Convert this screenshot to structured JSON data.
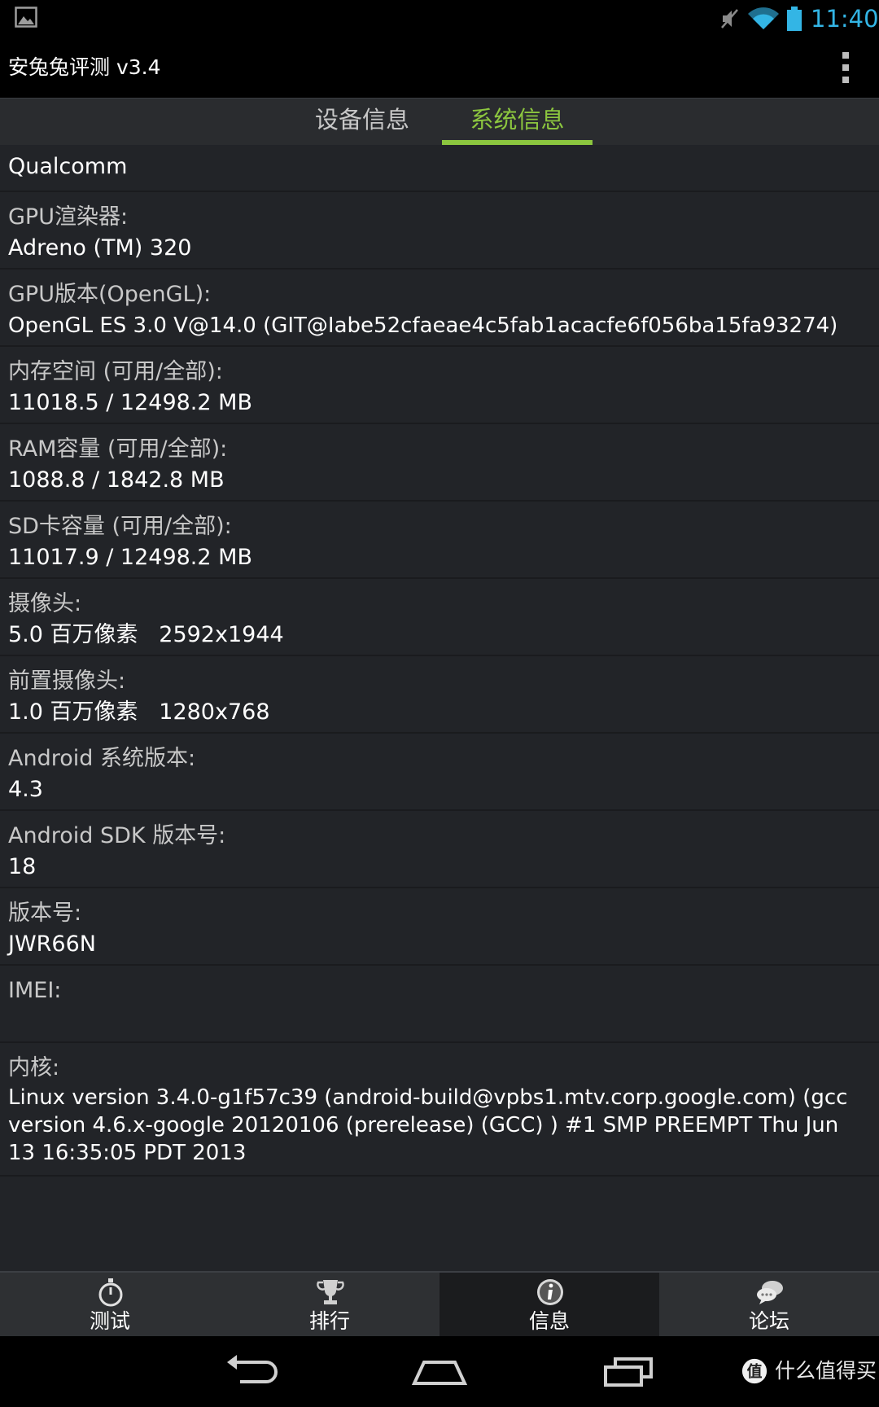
{
  "status_bar": {
    "time": "11:40",
    "icons": [
      "gallery-icon",
      "mute-icon",
      "wifi-icon",
      "battery-icon"
    ],
    "accent_color": "#33b5e5"
  },
  "app": {
    "title": "安兔兔评测 v3.4"
  },
  "tabs": [
    {
      "label": "设备信息",
      "active": false
    },
    {
      "label": "系统信息",
      "active": true
    }
  ],
  "accent_color": "#8cc63f",
  "info": {
    "cpu_vendor": "Qualcomm",
    "gpu_renderer": {
      "label": "GPU渲染器:",
      "value": "Adreno (TM) 320"
    },
    "gpu_version": {
      "label": "GPU版本(OpenGL):",
      "value": "OpenGL ES 3.0 V@14.0 (GIT@Iabe52cfaeae4c5fab1acacfe6f056ba15fa93274)"
    },
    "storage": {
      "label": "内存空间 (可用/全部):",
      "value": "11018.5 / 12498.2 MB"
    },
    "ram": {
      "label": "RAM容量 (可用/全部):",
      "value": "1088.8 / 1842.8 MB"
    },
    "sd": {
      "label": "SD卡容量 (可用/全部):",
      "value": "11017.9 / 12498.2 MB"
    },
    "camera": {
      "label": "摄像头:",
      "value": "5.0 百万像素   2592x1944"
    },
    "front_camera": {
      "label": "前置摄像头:",
      "value": "1.0 百万像素   1280x768"
    },
    "android_version": {
      "label": "Android 系统版本:",
      "value": "4.3"
    },
    "sdk": {
      "label": "Android SDK 版本号:",
      "value": "18"
    },
    "build": {
      "label": "版本号:",
      "value": "JWR66N"
    },
    "imei": {
      "label": "IMEI:",
      "value": ""
    },
    "kernel": {
      "label": "内核:",
      "value": "Linux version 3.4.0-g1f57c39 (android-build@vpbs1.mtv.corp.google.com) (gcc version 4.6.x-google 20120106 (prerelease) (GCC) ) #1 SMP PREEMPT Thu Jun 13 16:35:05 PDT 2013"
    }
  },
  "bottom_nav": [
    {
      "label": "测试",
      "icon": "stopwatch-icon",
      "active": false
    },
    {
      "label": "排行",
      "icon": "trophy-icon",
      "active": false
    },
    {
      "label": "信息",
      "icon": "info-icon",
      "active": true
    },
    {
      "label": "论坛",
      "icon": "chat-bubbles-icon",
      "active": false
    }
  ],
  "system_nav": {
    "buttons": [
      "back-icon",
      "home-icon",
      "recents-icon"
    ],
    "watermark": "什么值得买"
  }
}
